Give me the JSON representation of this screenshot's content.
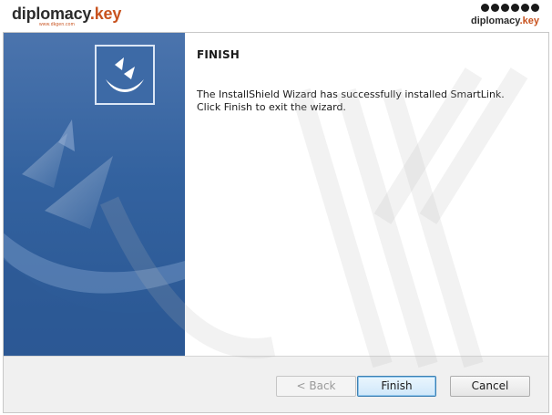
{
  "branding": {
    "left_name": "diplomacy",
    "left_dot": ".",
    "left_key": "key",
    "left_subtitle": "www.dkgen.com",
    "right_name": "diplomacy",
    "right_dot": ".",
    "right_key": "key",
    "social_icons": [
      "facebook-icon",
      "twitter-icon",
      "instagram-icon",
      "pinterest-icon",
      "youtube-icon",
      "facebook-icon"
    ]
  },
  "wizard": {
    "title": "FINISH",
    "message_line1": "The InstallShield Wizard has successfully installed SmartLink.",
    "message_line2": "Click Finish to exit the wizard.",
    "buttons": {
      "back": "< Back",
      "finish": "Finish",
      "cancel": "Cancel"
    }
  },
  "colors": {
    "panel_blue": "#33629f",
    "brand_orange": "#c8521e",
    "focus_border": "#3c7fb1"
  }
}
